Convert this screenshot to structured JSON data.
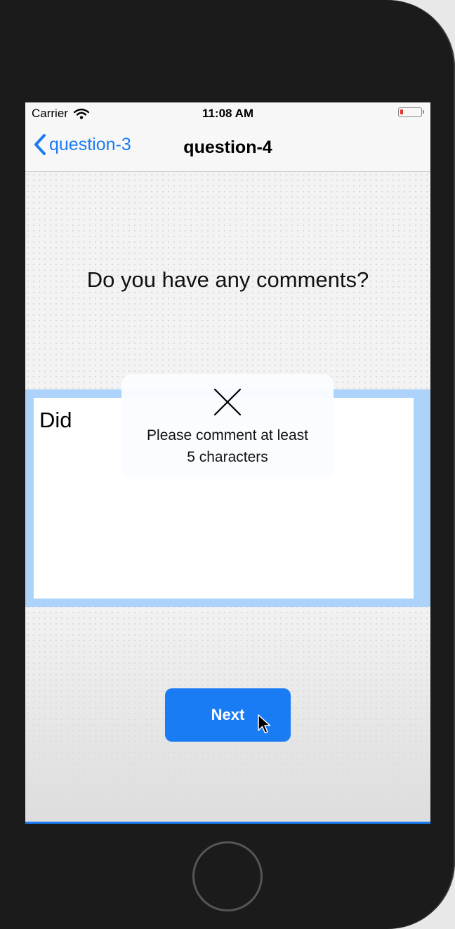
{
  "status_bar": {
    "carrier": "Carrier",
    "time": "11:08 AM"
  },
  "nav": {
    "back_label": "question-3",
    "title": "question-4"
  },
  "question": {
    "text": "Do you have any comments?"
  },
  "comment": {
    "value": "Did"
  },
  "toast": {
    "message_line1": "Please comment at least",
    "message_line2": "5 characters"
  },
  "next_button": {
    "label": "Next"
  },
  "colors": {
    "accent": "#1a7cf5",
    "input_border": "#aed3fb",
    "battery_low": "#e0342c"
  },
  "icons": [
    "wifi-icon",
    "battery-icon",
    "back-chevron-icon",
    "close-icon",
    "cursor-icon"
  ]
}
